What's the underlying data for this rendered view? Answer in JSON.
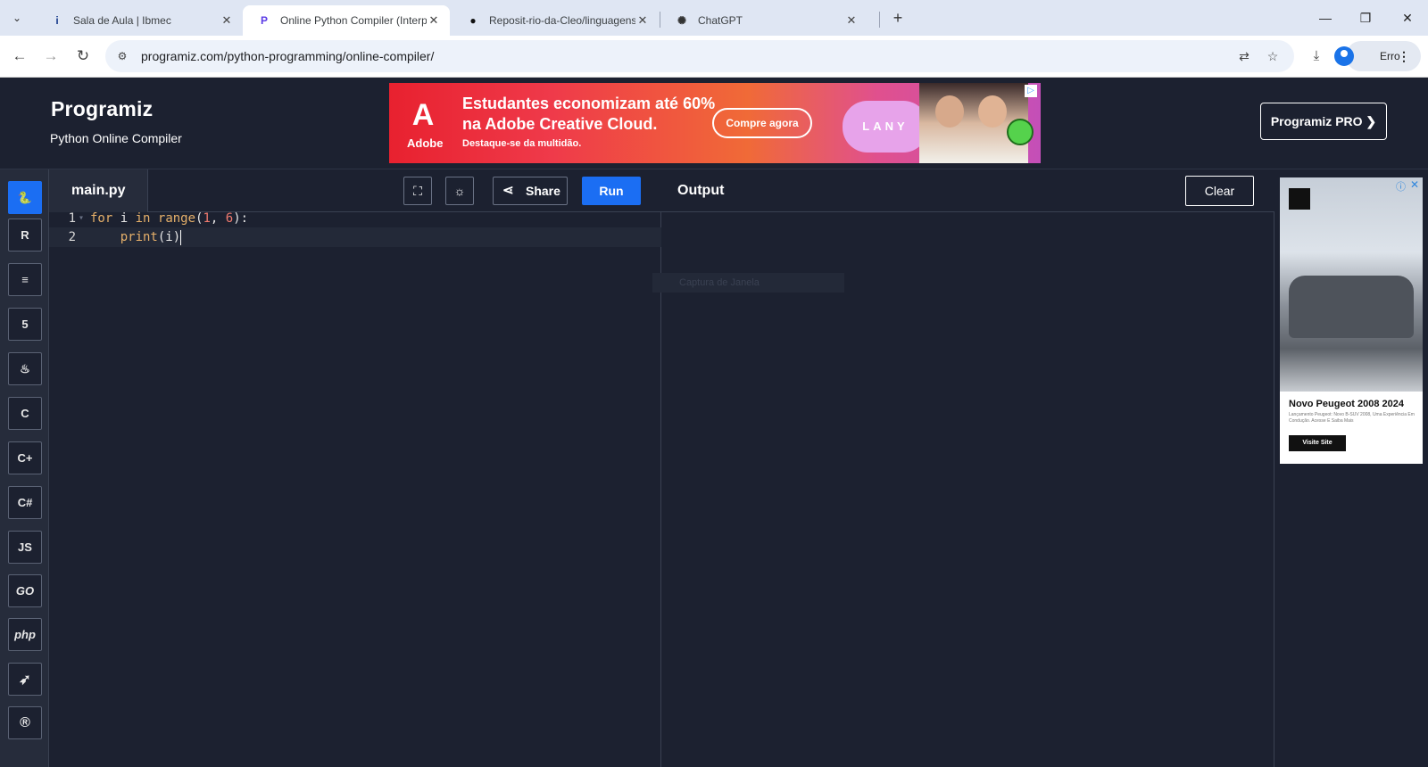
{
  "browser": {
    "tabs": [
      {
        "title": "Sala de Aula | Ibmec",
        "favicon": "ibmec-icon",
        "active": false
      },
      {
        "title": "Online Python Compiler (Interp",
        "favicon": "programiz-icon",
        "active": true
      },
      {
        "title": "Reposit-rio-da-Cleo/linguagens",
        "favicon": "github-icon",
        "active": false
      },
      {
        "title": "ChatGPT",
        "favicon": "chatgpt-icon",
        "active": false
      }
    ],
    "url": "programiz.com/python-programming/online-compiler/",
    "profile_label": "Erro"
  },
  "header": {
    "logo": "Programiz",
    "subtitle": "Python Online Compiler",
    "pro_button": "Programiz PRO ❯"
  },
  "top_ad": {
    "brand": "Adobe",
    "headline": "Estudantes economizam até 60% na Adobe Creative Cloud.",
    "subline": "Destaque-se da multidão.",
    "cta": "Compre agora",
    "lany": "LANY"
  },
  "sidebar": {
    "languages": [
      {
        "name": "python",
        "glyph": "🐍",
        "active": true
      },
      {
        "name": "r",
        "glyph": "R"
      },
      {
        "name": "sql",
        "glyph": "≡"
      },
      {
        "name": "html",
        "glyph": "5"
      },
      {
        "name": "java",
        "glyph": "♨"
      },
      {
        "name": "c",
        "glyph": "C"
      },
      {
        "name": "cpp",
        "glyph": "C+"
      },
      {
        "name": "csharp",
        "glyph": "C#"
      },
      {
        "name": "javascript",
        "glyph": "JS"
      },
      {
        "name": "go",
        "glyph": "GO"
      },
      {
        "name": "php",
        "glyph": "php"
      },
      {
        "name": "swift",
        "glyph": "➶"
      },
      {
        "name": "rust",
        "glyph": "®"
      }
    ]
  },
  "editor": {
    "filename": "main.py",
    "share_label": "Share",
    "run_label": "Run",
    "lines": [
      {
        "number": "1",
        "kw1": "for",
        "t1": " i ",
        "kw2": "in",
        "t2": " ",
        "fn": "range",
        "t3": "(",
        "n1": "1",
        "t4": ", ",
        "n2": "6",
        "t5": "):"
      },
      {
        "number": "2",
        "indent": "    ",
        "fn": "print",
        "t1": "(i)"
      }
    ]
  },
  "output": {
    "title": "Output",
    "clear_label": "Clear",
    "ghost_text": "Captura de Janela"
  },
  "side_ad": {
    "title": "Novo Peugeot 2008 2024",
    "description": "Lançamento Peugeot: Novo B-SUV 2008, Uma Experiência Em Condução. Acesse E Saiba Mais",
    "cta": "Visite Site"
  }
}
